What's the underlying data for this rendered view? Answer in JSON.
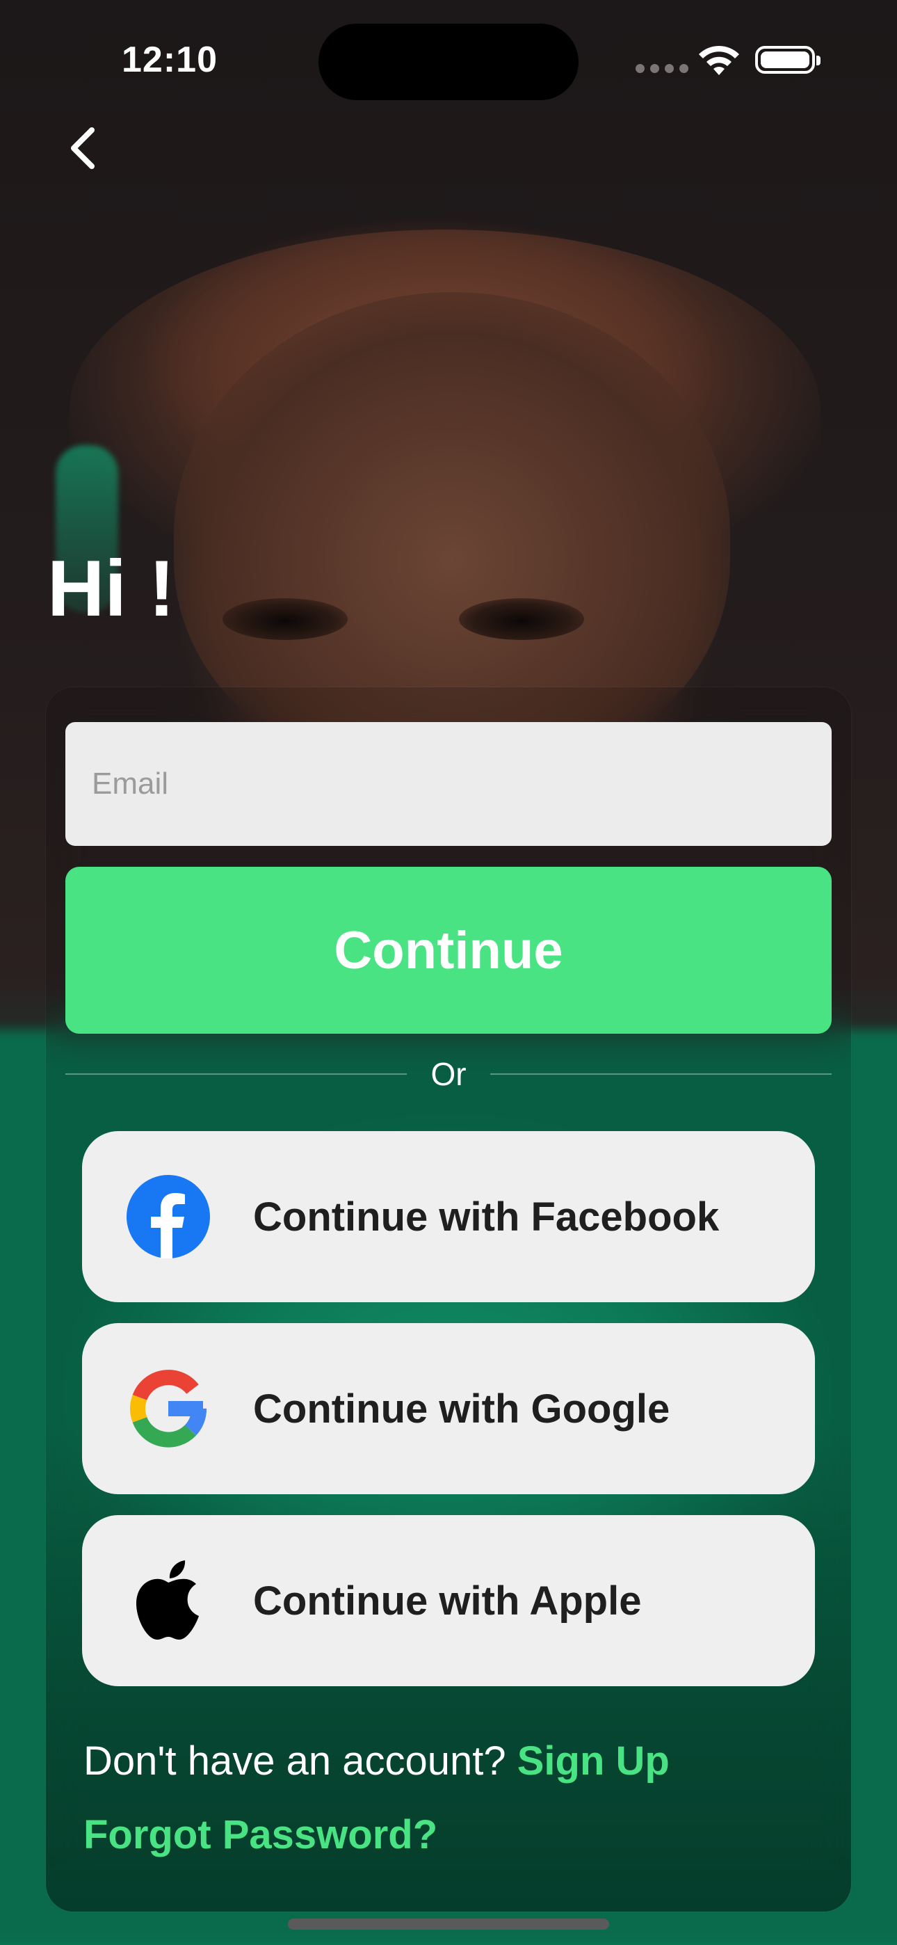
{
  "status_bar": {
    "time": "12:10"
  },
  "screen": {
    "greeting": "Hi !"
  },
  "login_form": {
    "email_placeholder": "Email",
    "email_value": "",
    "continue_label": "Continue",
    "divider_text": "Or"
  },
  "social_login": [
    {
      "label": "Continue with Facebook",
      "icon": "facebook-icon"
    },
    {
      "label": "Continue with Google",
      "icon": "google-icon"
    },
    {
      "label": "Continue with Apple",
      "icon": "apple-icon"
    }
  ],
  "footer": {
    "signup_prompt": "Don't have an account?",
    "signup_link": "Sign Up",
    "forgot_password": "Forgot Password?"
  },
  "colors": {
    "accent": "#4ae383",
    "button_bg": "#efefef",
    "input_bg": "#ececec"
  }
}
